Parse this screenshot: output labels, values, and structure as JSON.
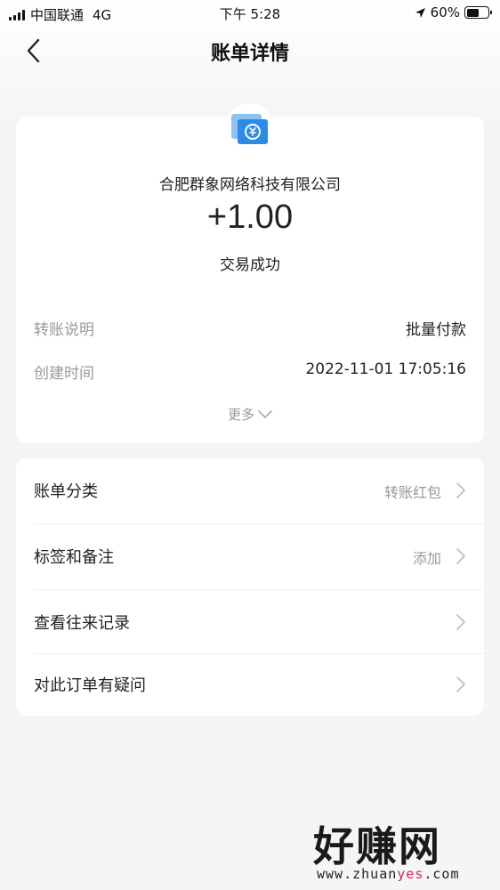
{
  "status_bar": {
    "carrier": "中国联通",
    "network": "4G",
    "time": "下午 5:28",
    "battery_percent": "60%",
    "battery_level": 0.6
  },
  "nav": {
    "title": "账单详情",
    "back_icon": "chevron-left-icon"
  },
  "transaction": {
    "icon": "transfer-icon",
    "merchant": "合肥群象网络科技有限公司",
    "amount": "+1.00",
    "status": "交易成功",
    "details": [
      {
        "label": "转账说明",
        "value": "批量付款"
      },
      {
        "label": "创建时间",
        "value": "2022-11-01 17:05:16"
      }
    ],
    "more_label": "更多"
  },
  "menu": [
    {
      "label": "账单分类",
      "value": "转账红包"
    },
    {
      "label": "标签和备注",
      "value": "添加"
    },
    {
      "label": "查看往来记录",
      "value": ""
    },
    {
      "label": "对此订单有疑问",
      "value": ""
    }
  ],
  "watermark": {
    "title": "好赚网",
    "url_prefix": "www.zhuan",
    "url_highlight": "yes",
    "url_suffix": ".com"
  },
  "colors": {
    "accent_blue": "#2b8ce8",
    "secondary_text": "#999999",
    "background": "#f5f5f5"
  }
}
